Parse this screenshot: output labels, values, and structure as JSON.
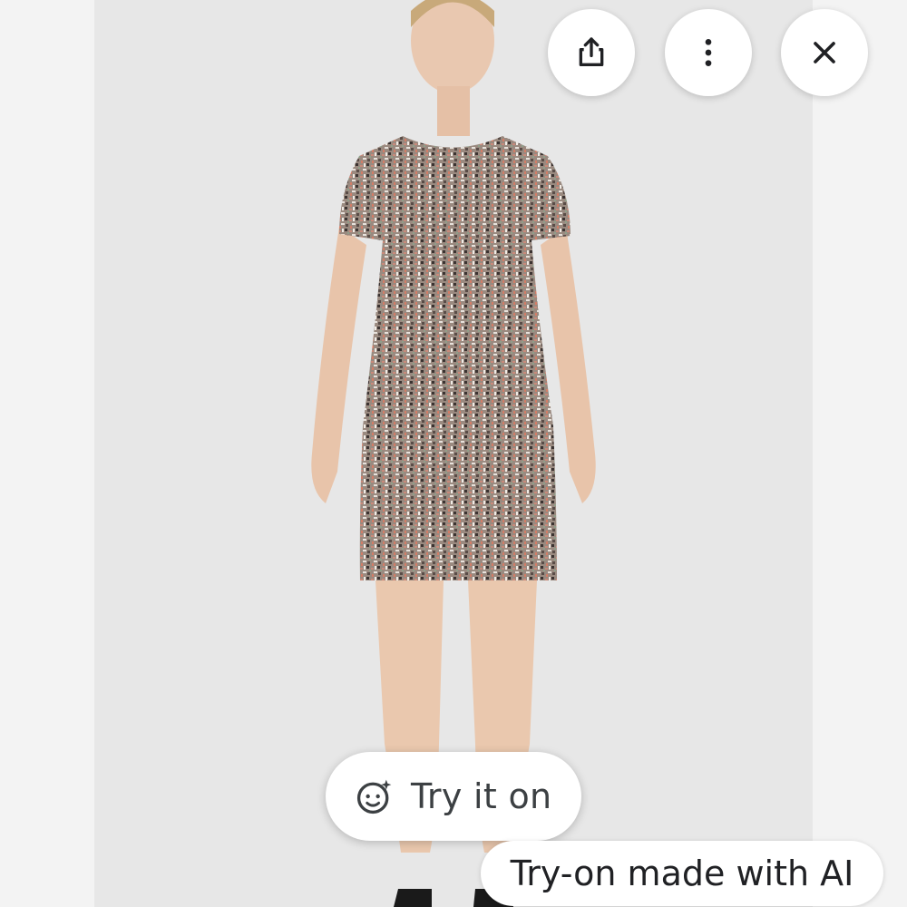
{
  "photo": {
    "alt": "Model wearing a short-sleeve tweed sheath dress"
  },
  "toolbar": {
    "share_icon": "share-icon",
    "more_icon": "more-vert-icon",
    "close_icon": "close-icon"
  },
  "try_on": {
    "label": "Try it on",
    "icon": "face-sparkle-icon"
  },
  "ai_notice": {
    "text": "Try-on made with AI"
  },
  "colors": {
    "background": "#f3f3f3",
    "photo_bg": "#e7e7e7",
    "button_bg": "#ffffff",
    "icon_color": "#202124"
  }
}
